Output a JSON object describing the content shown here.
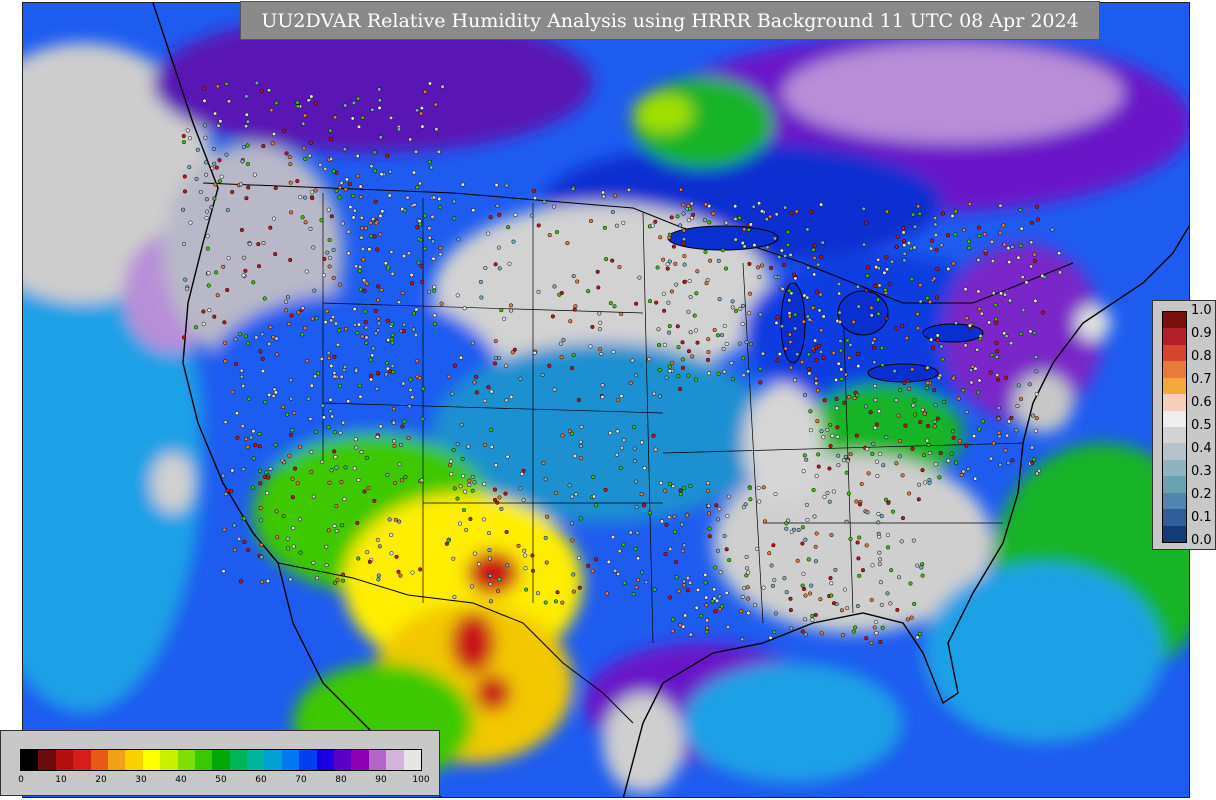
{
  "title": "UU2DVAR Relative Humidity Analysis using HRRR Background 11 UTC 08 Apr 2024",
  "qc_legend": {
    "labels": [
      "1.0",
      "0.9",
      "0.8",
      "0.7",
      "0.6",
      "0.5",
      "0.4",
      "0.3",
      "0.2",
      "0.1",
      "0.0"
    ],
    "colors": [
      "#7a1010",
      "#b2202a",
      "#d6452f",
      "#e87a3a",
      "#f4a83a",
      "#f6cfbb",
      "#eeeeee",
      "#d3d3d3",
      "#b5c3cc",
      "#8fb4c0",
      "#6aa3b0",
      "#4f87b0",
      "#2e5f99",
      "#153a7a"
    ]
  },
  "rh_legend": {
    "ticks": [
      "0",
      "10",
      "20",
      "30",
      "40",
      "50",
      "60",
      "70",
      "80",
      "90",
      "100"
    ],
    "colors": [
      "#000000",
      "#6a0a0a",
      "#b40f0f",
      "#d81c1c",
      "#e85a1a",
      "#f2a014",
      "#ffd000",
      "#ffff00",
      "#c8f000",
      "#7ee000",
      "#3cc800",
      "#00a800",
      "#00b45a",
      "#00b4a0",
      "#00a0d0",
      "#0078f0",
      "#0040f0",
      "#1a00e0",
      "#5a00c8",
      "#8c00b4",
      "#b464c8",
      "#d2b4dc",
      "#e6e6e6"
    ]
  },
  "map": {
    "colors": {
      "ocean_blue": "#1e5cf0",
      "deep_blue": "#0a2fd0",
      "cyan": "#1ea0e6",
      "purple": "#6a14c8",
      "light_purple": "#b88ed8",
      "gray": "#c8c8c8",
      "green": "#14b428",
      "yellow_green": "#a0e000",
      "yellow": "#ffee00",
      "orange": "#ffaa00",
      "red": "#c81414",
      "boundary": "#000000"
    }
  }
}
